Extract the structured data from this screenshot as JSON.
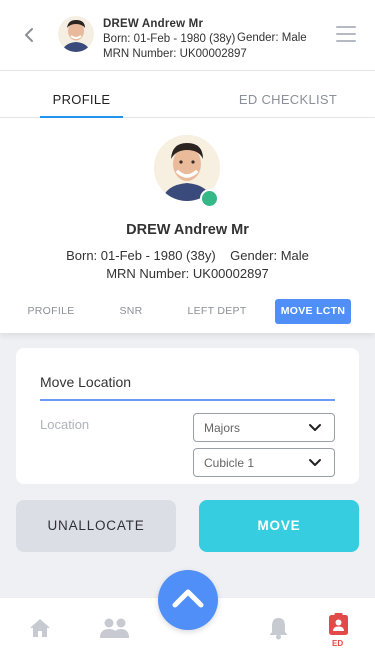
{
  "header": {
    "name": "DREW Andrew Mr",
    "born": "Born: 01-Feb - 1980 (38y)",
    "gender": "Gender: Male",
    "mrn": "MRN Number: UK00002897"
  },
  "main_tabs": [
    {
      "label": "PROFILE",
      "active": true
    },
    {
      "label": "ED CHECKLIST",
      "active": false
    }
  ],
  "profile": {
    "name": "DREW Andrew Mr",
    "born_gender": "Born: 01-Feb - 1980 (38y)    Gender: Male",
    "mrn": "MRN Number: UK00002897",
    "status_color": "#35b887"
  },
  "sub_tabs": [
    {
      "label": "PROFILE",
      "active": false
    },
    {
      "label": "SNR",
      "active": false
    },
    {
      "label": "LEFT DEPT",
      "active": false
    },
    {
      "label": "MOVE LCTN",
      "active": true
    }
  ],
  "move_location": {
    "title": "Move Location",
    "location_label": "Location",
    "area_value": "Majors",
    "bay_value": "Cubicle 1"
  },
  "actions": {
    "unallocate_label": "UNALLOCATE",
    "move_label": "MOVE"
  },
  "bottom_nav": {
    "items": [
      "home-icon",
      "people-icon",
      "chevron-up-icon",
      "bell-icon",
      "ed-badge-icon"
    ],
    "ed_label": "ED"
  },
  "colors": {
    "accent_blue": "#4f8ff7",
    "move_button": "#37cde0",
    "ed_red": "#e24a4a"
  }
}
